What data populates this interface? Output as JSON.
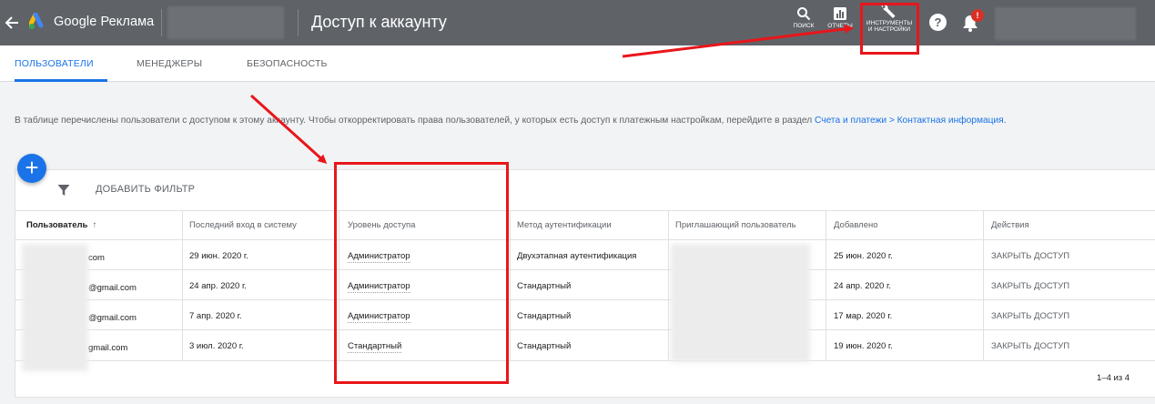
{
  "header": {
    "brand": "Google Реклама",
    "title": "Доступ к аккаунту",
    "search_label": "поиск",
    "reports_label": "отчеты",
    "tools_label_1": "инструменты",
    "tools_label_2": "и настройки",
    "help_glyph": "?",
    "notification_badge": "!"
  },
  "tabs": [
    {
      "label": "Пользователи",
      "active": true
    },
    {
      "label": "Менеджеры",
      "active": false
    },
    {
      "label": "Безопасность",
      "active": false
    }
  ],
  "description": {
    "text": "В таблице перечислены пользователи с доступом к этому аккаунту. Чтобы откорректировать права пользователей, у которых есть доступ к платежным настройкам, перейдите в раздел ",
    "link": "Счета и платежи > Контактная информация",
    "end": "."
  },
  "toolbar": {
    "fab_glyph": "+",
    "add_filter": "Добавить фильтр"
  },
  "table": {
    "columns": [
      "Пользователь",
      "Последний вход в систему",
      "Уровень доступа",
      "Метод аутентификации",
      "Приглашающий пользователь",
      "Добавлено",
      "Действия"
    ],
    "sort_glyph": "↑",
    "rows": [
      {
        "user": "com",
        "last_login": "29 июн. 2020 г.",
        "access": "Администратор",
        "auth": "Двухэтапная аутентификация",
        "added": "25 июн. 2020 г.",
        "action": "Закрыть доступ"
      },
      {
        "user": "@gmail.com",
        "last_login": "24 апр. 2020 г.",
        "access": "Администратор",
        "auth": "Стандартный",
        "added": "24 апр. 2020 г.",
        "action": "Закрыть доступ"
      },
      {
        "user": "@gmail.com",
        "last_login": "7 апр. 2020 г.",
        "access": "Администратор",
        "auth": "Стандартный",
        "added": "17 мар. 2020 г.",
        "action": "Закрыть доступ"
      },
      {
        "user": "gmail.com",
        "last_login": "3 июл. 2020 г.",
        "access": "Стандартный",
        "auth": "Стандартный",
        "added": "19 июн. 2020 г.",
        "action": "Закрыть доступ"
      }
    ],
    "pagination": "1–4 из 4"
  },
  "colors": {
    "topbar": "#5f6368",
    "accent": "#1a73e8",
    "annotation": "#e8161b"
  }
}
